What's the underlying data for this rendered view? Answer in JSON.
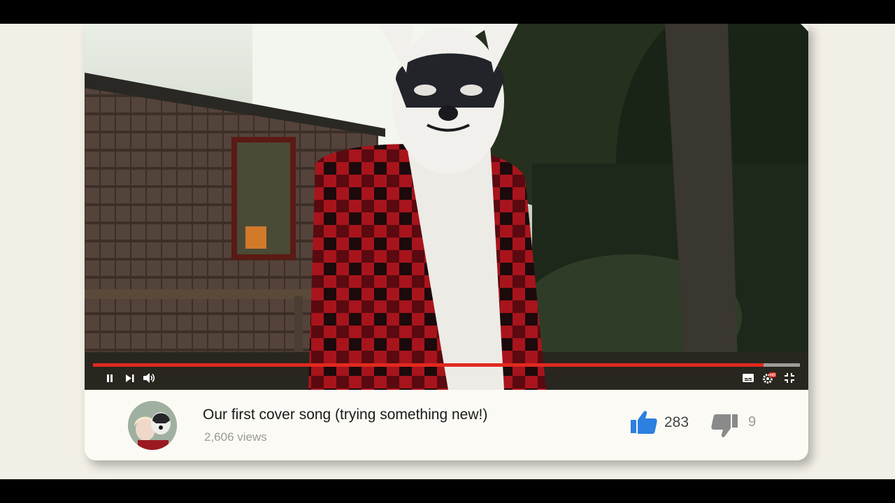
{
  "player": {
    "progress": 0.949,
    "colors": {
      "progress": "#e1291f",
      "track": "#ffffff"
    },
    "controls": {
      "play_pause": "pause-icon",
      "next": "skip-next-icon",
      "volume": "volume-icon",
      "captions": "captions-icon",
      "settings": "settings-gear-hd-icon",
      "fullscreen": "exit-fullscreen-icon"
    },
    "hd_badge": "HD"
  },
  "video": {
    "title": "Our first cover song (trying something new!)",
    "views": "2,606 views"
  },
  "ratings": {
    "likes": "283",
    "dislikes": "9",
    "like_color": "#2d7fe0",
    "dislike_color": "#8a8a8a"
  }
}
